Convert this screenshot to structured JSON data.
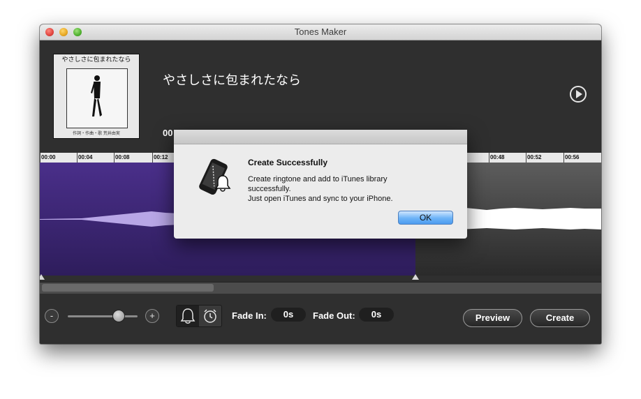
{
  "window": {
    "title": "Tones Maker"
  },
  "album": {
    "cover_title": "やさしさに包まれたなら",
    "cover_caption": "作詞・作曲・歌 荒井由実"
  },
  "song": {
    "title": "やさしさに包まれたなら",
    "time_partial": "00"
  },
  "ruler": {
    "labels_left": [
      "00:00",
      "00:04",
      "00:08",
      "00:12"
    ],
    "labels_right": [
      "00:48",
      "00:52",
      "00:56"
    ]
  },
  "controls": {
    "zoom_out_label": "-",
    "zoom_in_label": "+",
    "zoom_level": 0.75,
    "mode": "ringtone",
    "fade_in_label": "Fade In:",
    "fade_in_value": "0s",
    "fade_out_label": "Fade Out:",
    "fade_out_value": "0s",
    "preview_label": "Preview",
    "create_label": "Create"
  },
  "dialog": {
    "title": "Create Successfully",
    "message_lines": [
      "Create ringtone and add to iTunes library",
      "successfully.",
      "Just open iTunes and sync to your iPhone."
    ],
    "ok_label": "OK"
  },
  "colors": {
    "selection": "#3a2473",
    "waveform_selected": "#b8a6e6",
    "waveform_unselected": "#ffffff",
    "ok_button": "#6cb3f7"
  }
}
